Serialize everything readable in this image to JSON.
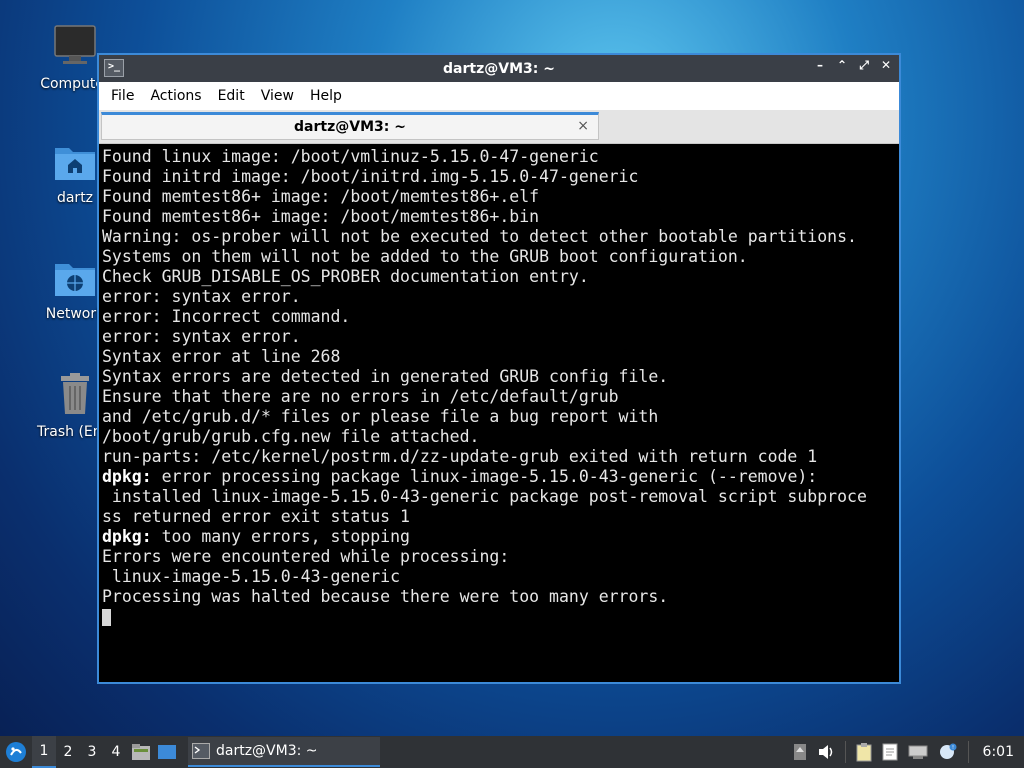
{
  "desktop": {
    "icons": [
      {
        "label": "Computer",
        "icon": "computer-icon"
      },
      {
        "label": "dartz",
        "icon": "home-folder-icon"
      },
      {
        "label": "Network",
        "icon": "network-folder-icon"
      },
      {
        "label": "Trash (Empty)",
        "icon": "trash-icon"
      }
    ]
  },
  "window": {
    "title": "dartz@VM3: ~",
    "controls": {
      "minimize": "–",
      "maximize": "⌃",
      "restore": "⤢",
      "close": "✕"
    }
  },
  "menubar": [
    "File",
    "Actions",
    "Edit",
    "View",
    "Help"
  ],
  "tab": {
    "label": "dartz@VM3: ~",
    "close": "×"
  },
  "terminal": {
    "lines": [
      {
        "prefix": "",
        "text": "Found linux image: /boot/vmlinuz-5.15.0-47-generic"
      },
      {
        "prefix": "",
        "text": "Found initrd image: /boot/initrd.img-5.15.0-47-generic"
      },
      {
        "prefix": "",
        "text": "Found memtest86+ image: /boot/memtest86+.elf"
      },
      {
        "prefix": "",
        "text": "Found memtest86+ image: /boot/memtest86+.bin"
      },
      {
        "prefix": "",
        "text": "Warning: os-prober will not be executed to detect other bootable partitions."
      },
      {
        "prefix": "",
        "text": "Systems on them will not be added to the GRUB boot configuration."
      },
      {
        "prefix": "",
        "text": "Check GRUB_DISABLE_OS_PROBER documentation entry."
      },
      {
        "prefix": "",
        "text": "error: syntax error."
      },
      {
        "prefix": "",
        "text": "error: Incorrect command."
      },
      {
        "prefix": "",
        "text": "error: syntax error."
      },
      {
        "prefix": "",
        "text": "Syntax error at line 268"
      },
      {
        "prefix": "",
        "text": "Syntax errors are detected in generated GRUB config file."
      },
      {
        "prefix": "",
        "text": "Ensure that there are no errors in /etc/default/grub"
      },
      {
        "prefix": "",
        "text": "and /etc/grub.d/* files or please file a bug report with"
      },
      {
        "prefix": "",
        "text": "/boot/grub/grub.cfg.new file attached."
      },
      {
        "prefix": "",
        "text": "run-parts: /etc/kernel/postrm.d/zz-update-grub exited with return code 1"
      },
      {
        "prefix": "dpkg:",
        "text": " error processing package linux-image-5.15.0-43-generic (--remove):"
      },
      {
        "prefix": "",
        "text": " installed linux-image-5.15.0-43-generic package post-removal script subproce"
      },
      {
        "prefix": "",
        "text": "ss returned error exit status 1"
      },
      {
        "prefix": "dpkg:",
        "text": " too many errors, stopping"
      },
      {
        "prefix": "",
        "text": "Errors were encountered while processing:"
      },
      {
        "prefix": "",
        "text": " linux-image-5.15.0-43-generic"
      },
      {
        "prefix": "",
        "text": "Processing was halted because there were too many errors."
      }
    ]
  },
  "taskbar": {
    "workspaces": [
      "1",
      "2",
      "3",
      "4"
    ],
    "active_workspace": "1",
    "task_label": "dartz@VM3: ~",
    "clock": "6:01"
  },
  "colors": {
    "accent": "#3c8ad8",
    "titlebar": "#3a3f47",
    "terminal_bg": "#000000",
    "taskbar": "#2f3236"
  }
}
